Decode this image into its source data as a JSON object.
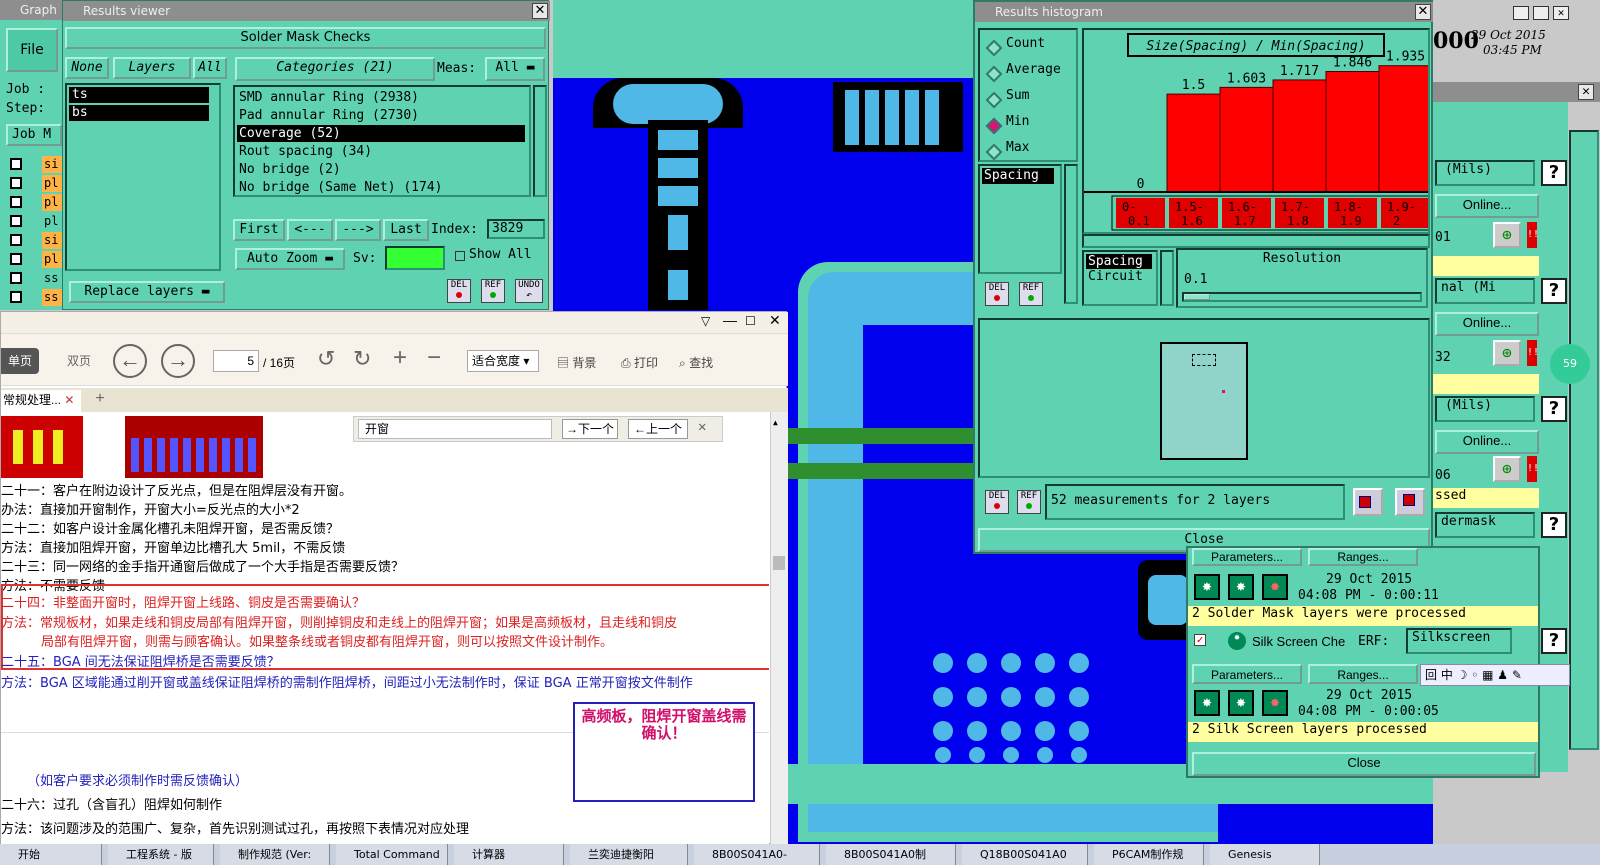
{
  "graph_window": {
    "title": "Graph",
    "file_menu": "File",
    "job_label": "Job :",
    "step_label": "Step:",
    "job_mgr": "Job M",
    "layers": [
      {
        "name": "si",
        "color": "#ffb347"
      },
      {
        "name": "pl",
        "color": "#ffb347"
      },
      {
        "name": "pl",
        "color": "#ffb347"
      },
      {
        "name": "pl",
        "color": "#5fd3b1"
      },
      {
        "name": "si",
        "color": "#ffb347"
      },
      {
        "name": "pl",
        "color": "#ffb347"
      },
      {
        "name": "ss",
        "color": "#5fd3b1"
      },
      {
        "name": "ss",
        "color": "#ffb347"
      }
    ]
  },
  "results_viewer": {
    "title": "Results viewer",
    "header": "Solder Mask Checks",
    "none_btn": "None",
    "layers_btn": "Layers",
    "all_btn": "All",
    "layers": [
      "ts",
      "bs"
    ],
    "categories_label": "Categories (21)",
    "meas_label": "Meas:",
    "meas_value": "All",
    "categories": [
      "SMD annular Ring (2938)",
      "Pad annular Ring (2730)",
      "Coverage (52)",
      "Rout spacing (34)",
      "No bridge (2)",
      "No bridge (Same Net) (174)"
    ],
    "selected_category": 2,
    "nav": {
      "first": "First",
      "prev": "<---",
      "next": "--->",
      "last": "Last",
      "index_label": "Index:",
      "index_value": "3829"
    },
    "auto_zoom": "Auto Zoom",
    "sv_label": "Sv:",
    "show_all": "Show All",
    "replace_layers": "Replace layers",
    "icons": [
      "DEL",
      "REF",
      "UNDO"
    ]
  },
  "histogram": {
    "title": "Results histogram",
    "modes": [
      "Count",
      "Average",
      "Sum",
      "Min",
      "Max"
    ],
    "selected_mode": "Min",
    "chart_title": "Size(Spacing) / Min(Spacing)",
    "list_items": [
      "Spacing"
    ],
    "spacing_circuit": [
      "Spacing",
      "Circuit"
    ],
    "resolution_label": "Resolution",
    "resolution_value": "0.1",
    "measurements": "52 measurements for 2 layers",
    "close": "Close",
    "del": "DEL",
    "ref": "REF"
  },
  "chart_data": {
    "type": "bar",
    "title": "Size(Spacing) / Min(Spacing)",
    "categories": [
      "0-0.1",
      "1.5-1.6",
      "1.6-1.7",
      "1.7-1.8",
      "1.8-1.9",
      "1.9-2"
    ],
    "values": [
      0,
      1.5,
      1.603,
      1.717,
      1.846,
      1.935
    ],
    "value_labels": [
      "0",
      "1.5",
      "1.603",
      "1.717",
      "1.846",
      "1.935"
    ],
    "ylim": [
      0,
      2
    ],
    "color": "#ff0000"
  },
  "right_panel": {
    "date_top": "29 Oct 2015",
    "time_top": "03:45 PM",
    "mils": "(Mils)",
    "online": "Online...",
    "parameters": "Parameters...",
    "ranges": "Ranges...",
    "row_texts": [
      "01",
      "nal (Mi",
      "32",
      "(Mils)",
      "06",
      "ssed",
      "dermask"
    ],
    "solder_date": "29 Oct 2015",
    "solder_time": "04:08 PM - 0:00:11",
    "solder_status": "2 Solder Mask layers were processed",
    "silk_label": "Silk Screen Che",
    "erf_label": "ERF:",
    "erf_value": "Silkscreen",
    "silk_date": "29 Oct 2015",
    "silk_time": "04:08 PM - 0:00:05",
    "silk_status": "2 Silk Screen layers processed",
    "close": "Close",
    "badge": "59"
  },
  "pdf": {
    "tab": "常规处理...",
    "single": "单页",
    "double": "双页",
    "page": "5",
    "pages": "/ 16页",
    "fit": "适合宽度",
    "bg": "背景",
    "print": "打印",
    "find": "查找",
    "search_value": "开窗",
    "next_btn": "→下一个",
    "prev_btn": "←上一个",
    "lines": [
      "二十一：客户在附边设计了反光点，但是在阻焊层没有开窗。",
      "办法：直接加开窗制作，开窗大小=反光点的大小*2",
      "二十二：如客户设计金属化槽孔未阻焊开窗，是否需反馈？",
      "方法：直接加阻焊开窗，开窗单边比槽孔大 5mil，不需反馈",
      "二十三：同一网络的金手指开通窗后做成了一个大手指是否需要反馈？",
      "方法：不需要反馈"
    ],
    "red_lines": [
      "二十四：非整面开窗时，阻焊开窗上线路、铜皮是否需要确认？",
      "方法：常规板材，如果走线和铜皮局部有阻焊开窗，则削掉铜皮和走线上的阻焊开窗；如果是高频板材，且走线和铜皮",
      "局部有阻焊开窗，则需与顾客确认。如果整条线或者铜皮都有阻焊开窗，则可以按照文件设计制作。"
    ],
    "blue_lines": [
      "二十五：BGA 间无法保证阻焊桥是否需要反馈？",
      "方法：BGA 区域能通过削开窗或盖线保证阻焊桥的需制作阻焊桥，间距过小无法制作时，保证 BGA 正常开窗按文件制作"
    ],
    "note": "高频板，阻焊开窗盖线需确认！",
    "confirm": "（如客户要求必须制作时需反馈确认）",
    "l26": "二十六：过孔（含盲孔）阻焊如何制作",
    "l27": "方法：该问题涉及的范围广、复杂，首先识别测试过孔，再按照下表情况对应处理"
  },
  "taskbar": [
    "开始",
    "工程系统 - 版",
    "制作规范 (Ver:",
    "Total Command",
    "计算器",
    "兰奕迪捷衡阳",
    "8B00S041A0-",
    "8B00S041A0制",
    "Q18B00S041A0",
    "P6CAM制作规",
    "Genesis"
  ]
}
